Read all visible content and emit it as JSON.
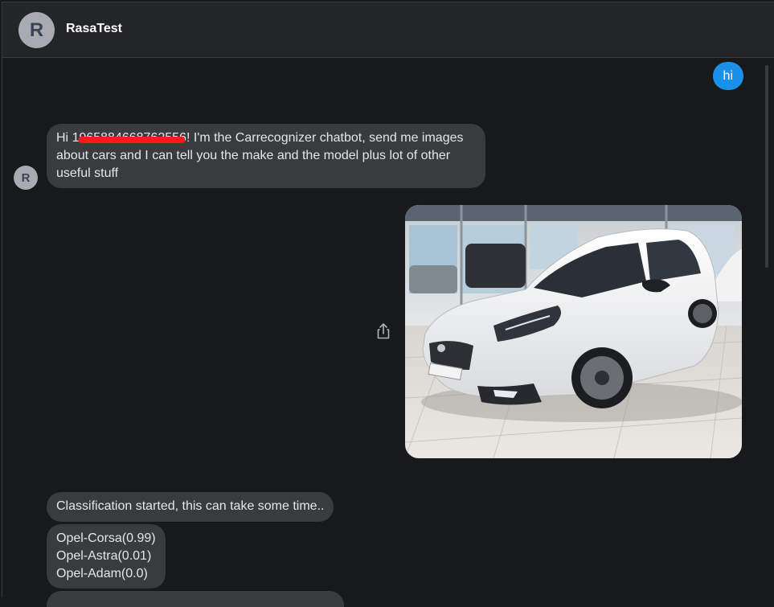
{
  "header": {
    "avatar_letter": "R",
    "title": "RasaTest"
  },
  "messages": {
    "user_text": "hi",
    "bot_avatar_letter": "R",
    "greeting_prefix": "Hi ",
    "greeting_redacted": "1965884668762556",
    "greeting_suffix": "! I'm the Carrecognizer chatbot, send me images about cars and I can tell you the make and the model plus lot of other useful stuff",
    "classification_started": "Classification started, this can take some time..",
    "results": "Opel-Corsa(0.99)\nOpel-Astra(0.01)\nOpel-Adam(0.0)"
  },
  "colors": {
    "background": "#18191b",
    "header": "#242526",
    "incoming_bubble": "#3a3b3c",
    "outgoing_bubble": "#1a91e8",
    "redaction": "#ff1a1a"
  },
  "icons": {
    "share": "share-icon"
  }
}
